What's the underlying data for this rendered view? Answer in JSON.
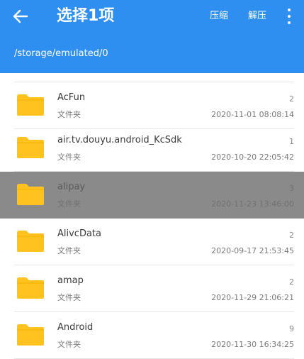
{
  "appbar": {
    "back_icon": "arrow-left-icon",
    "title": "选择1项",
    "compress_label": "压缩",
    "extract_label": "解压",
    "more_icon": "more-vertical-icon"
  },
  "path": "/storage/emulated/0",
  "colors": {
    "primary": "#2e8ff0",
    "folder": "#ffc21f",
    "selected_row": "#8a8a8a"
  },
  "files": [
    {
      "name": "AcFun",
      "type": "文件夹",
      "count": "2",
      "date": "2020-11-01 08:08:14",
      "selected": false
    },
    {
      "name": "air.tv.douyu.android_KcSdk",
      "type": "文件夹",
      "count": "1",
      "date": "2020-10-20 22:05:42",
      "selected": false
    },
    {
      "name": "alipay",
      "type": "文件夹",
      "count": "3",
      "date": "2020-11-23 13:46:00",
      "selected": true
    },
    {
      "name": "AlivcData",
      "type": "文件夹",
      "count": "2",
      "date": "2020-09-17 21:53:45",
      "selected": false
    },
    {
      "name": "amap",
      "type": "文件夹",
      "count": "2",
      "date": "2020-11-29 21:06:21",
      "selected": false
    },
    {
      "name": "Android",
      "type": "文件夹",
      "count": "9",
      "date": "2020-11-30 16:34:25",
      "selected": false
    }
  ]
}
